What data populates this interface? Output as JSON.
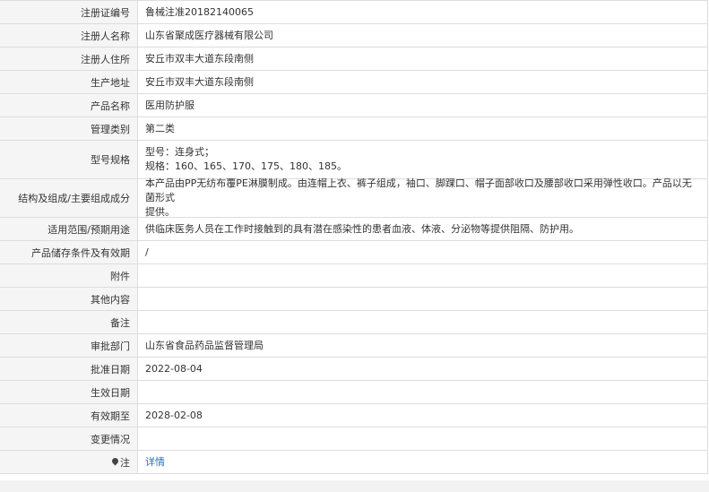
{
  "rows": [
    {
      "label": "注册证编号",
      "value": "鲁械注准20182140065"
    },
    {
      "label": "注册人名称",
      "value": "山东省聚成医疗器械有限公司"
    },
    {
      "label": "注册人住所",
      "value": "安丘市双丰大道东段南侧"
    },
    {
      "label": "生产地址",
      "value": "安丘市双丰大道东段南侧"
    },
    {
      "label": "产品名称",
      "value": "医用防护服"
    },
    {
      "label": "管理类别",
      "value": "第二类"
    },
    {
      "label": "型号规格",
      "value_line1": "型号：连身式；",
      "value_line2": "规格：160、165、170、175、180、185。"
    },
    {
      "label": "结构及组成/主要组成成分",
      "value_line1": "本产品由PP无纺布覆PE淋膜制成。由连帽上衣、裤子组成，袖口、脚踝口、帽子面部收口及腰部收口采用弹性收口。产品以无菌形式",
      "value_line2": "提供。"
    },
    {
      "label": "适用范围/预期用途",
      "value": "供临床医务人员在工作时接触到的具有潜在感染性的患者血液、体液、分泌物等提供阻隔、防护用。"
    },
    {
      "label": "产品储存条件及有效期",
      "value": "/"
    },
    {
      "label": "附件",
      "value": ""
    },
    {
      "label": "其他内容",
      "value": ""
    },
    {
      "label": "备注",
      "value": ""
    },
    {
      "label": "审批部门",
      "value": "山东省食品药品监督管理局"
    },
    {
      "label": "批准日期",
      "value": "2022-08-04"
    },
    {
      "label": "生效日期",
      "value": ""
    },
    {
      "label": "有效期至",
      "value": "2028-02-08"
    },
    {
      "label": "变更情况",
      "value": ""
    },
    {
      "label": "注",
      "value": "详情",
      "icon": "pin-icon"
    }
  ],
  "colors": {
    "label_bg": "#f5f5f5",
    "border": "#dddddd",
    "link": "#2a6fb8",
    "text": "#333333"
  }
}
